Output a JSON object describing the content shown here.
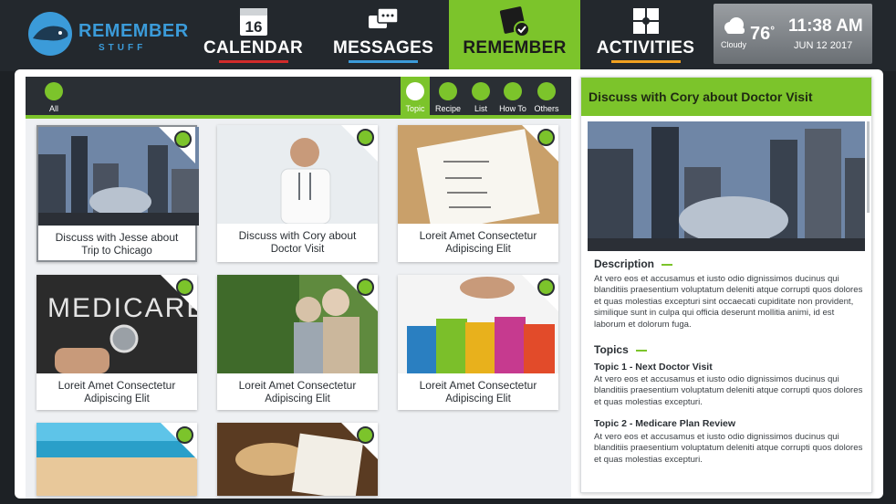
{
  "logo": {
    "line1": "REMEMBER",
    "line2": "STUFF"
  },
  "nav": [
    {
      "label": "CALENDAR",
      "icon": "calendar-icon",
      "icon_text": "16",
      "underline": "#d12b2b"
    },
    {
      "label": "MESSAGES",
      "icon": "chat-bubbles-icon",
      "underline": "#3b9bd9"
    },
    {
      "label": "REMEMBER",
      "icon": "remember-check-icon",
      "active": true
    },
    {
      "label": "ACTIVITIES",
      "icon": "puzzle-icon",
      "underline": "#f0a020"
    }
  ],
  "weather": {
    "condition": "Cloudy",
    "temp": "76",
    "degree": "°",
    "time": "11:38 AM",
    "date": "JUN 12 2017"
  },
  "categories": [
    {
      "label": "All",
      "icon": "grid-icon"
    },
    {
      "label": "Topic",
      "icon": "topic-icon",
      "active": true
    },
    {
      "label": "Recipe",
      "icon": "recipe-icon"
    },
    {
      "label": "List",
      "icon": "check-icon"
    },
    {
      "label": "How To",
      "icon": "map-icon"
    },
    {
      "label": "Others",
      "icon": "star-icon"
    }
  ],
  "cards": [
    {
      "line1": "Discuss with Jesse about",
      "line2": "Trip to Chicago",
      "image": "city-bean"
    },
    {
      "line1": "Discuss with Cory about",
      "line2": "Doctor Visit",
      "image": "doctor"
    },
    {
      "line1": "Loreit Amet Consectetur",
      "line2": "Adipiscing Elit",
      "image": "list-note"
    },
    {
      "line1": "Loreit Amet Consectetur",
      "line2": "Adipiscing Elit",
      "image": "medicare"
    },
    {
      "line1": "Loreit Amet Consectetur",
      "line2": "Adipiscing Elit",
      "image": "elderly-couple"
    },
    {
      "line1": "Loreit Amet Consectetur",
      "line2": "Adipiscing Elit",
      "image": "shopping-bags"
    },
    {
      "line1": "",
      "line2": "",
      "image": "beach"
    },
    {
      "line1": "",
      "line2": "",
      "image": "food"
    }
  ],
  "detail": {
    "title": "Discuss with Cory about Doctor Visit",
    "description_label": "Description",
    "description": "At vero eos et accusamus et iusto odio dignissimos ducinus qui blanditiis praesentium voluptatum deleniti atque corrupti quos dolores et quas molestias excepturi sint occaecati cupiditate non provident, similique sunt in culpa qui officia deserunt mollitia animi, id est laborum et dolorum fuga.",
    "topics_label": "Topics",
    "topics": [
      {
        "title": "Topic 1 - Next Doctor Visit",
        "text": "At vero eos et accusamus et iusto odio dignissimos ducinus qui blanditiis praesentium voluptatum deleniti atque corrupti quos dolores et quas molestias excepturi."
      },
      {
        "title": "Topic 2 - Medicare Plan Review",
        "text": "At vero eos et accusamus et iusto odio dignissimos ducinus qui blanditiis praesentium voluptatum deleniti atque corrupti quos dolores et quas molestias excepturi."
      }
    ]
  },
  "colors": {
    "accent": "#7cc42b",
    "bar": "#23282d",
    "brand": "#3b9bd9"
  }
}
